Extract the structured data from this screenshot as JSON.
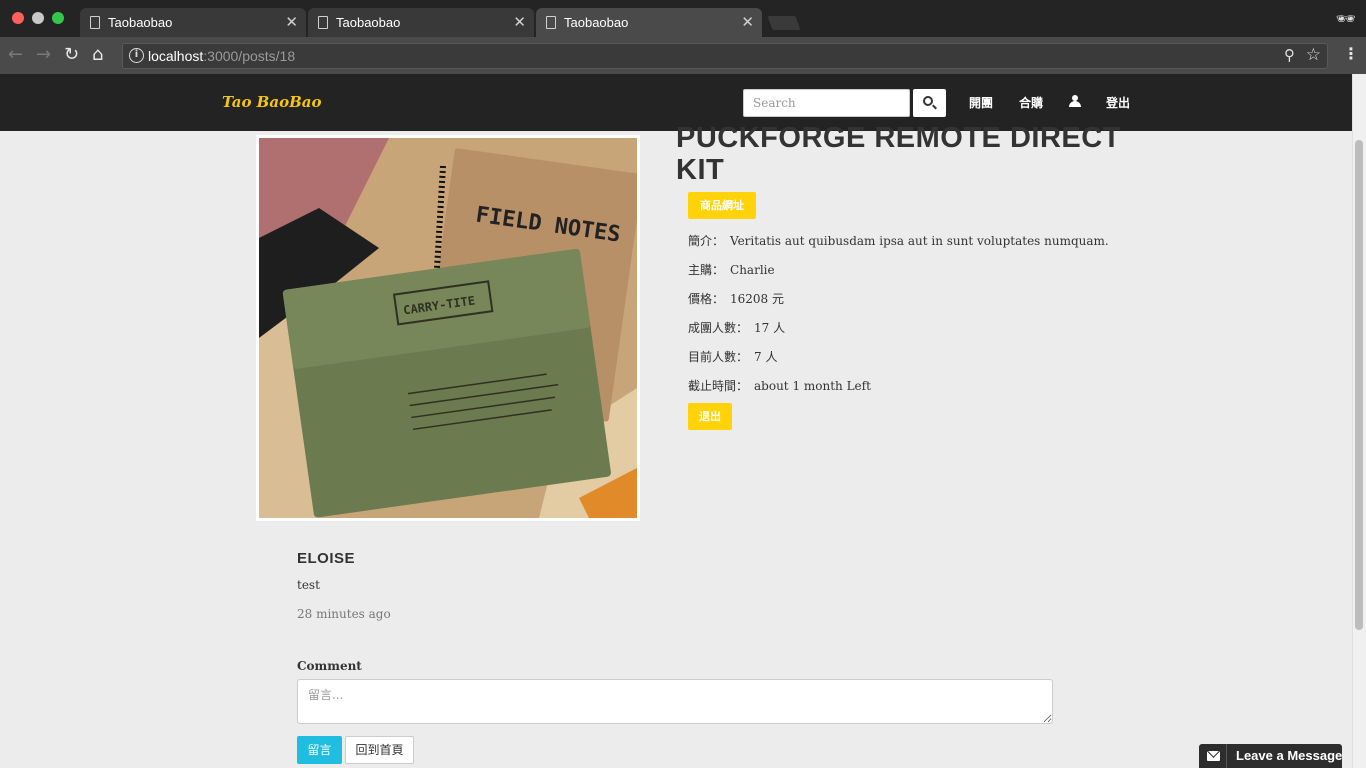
{
  "browser": {
    "tabs": [
      {
        "title": "Taobaobao"
      },
      {
        "title": "Taobaobao"
      },
      {
        "title": "Taobaobao"
      }
    ],
    "url_host": "localhost",
    "url_path": ":3000/posts/18"
  },
  "navbar": {
    "brand": "Tao BaoBao",
    "search_placeholder": "Search",
    "links": {
      "open_group": "開團",
      "group_buy": "合購",
      "logout": "登出"
    }
  },
  "product": {
    "title": "PUCKFORGE REMOTE DIRECT KIT",
    "link_button": "商品網址",
    "fields": {
      "intro_label": "簡介：",
      "intro_value": "Veritatis aut quibusdam ipsa aut in sunt voluptates numquam.",
      "host_label": "主購：",
      "host_value": "Charlie",
      "price_label": "價格：",
      "price_value": "16208 元",
      "min_label": "成團人數：",
      "min_value": "17 人",
      "current_label": "目前人數：",
      "current_value": "7 人",
      "deadline_label": "截止時間：",
      "deadline_value": "about 1 month Left"
    },
    "exit_button": "退出",
    "image_text": {
      "notebook": "FIELD NOTES",
      "pouch": "CARRY-TITE"
    }
  },
  "comment": {
    "author": "ELOISE",
    "body": "test",
    "time": "28 minutes ago"
  },
  "comment_form": {
    "label": "Comment",
    "placeholder": "留言...",
    "submit": "留言",
    "home": "回到首頁"
  },
  "chat_widget": {
    "label": "Leave a Message"
  },
  "colors": {
    "accent_yellow": "#ffd20a",
    "brand_yellow": "#f5c518",
    "submit_blue": "#1fbde0",
    "navbar_bg": "#232323"
  }
}
